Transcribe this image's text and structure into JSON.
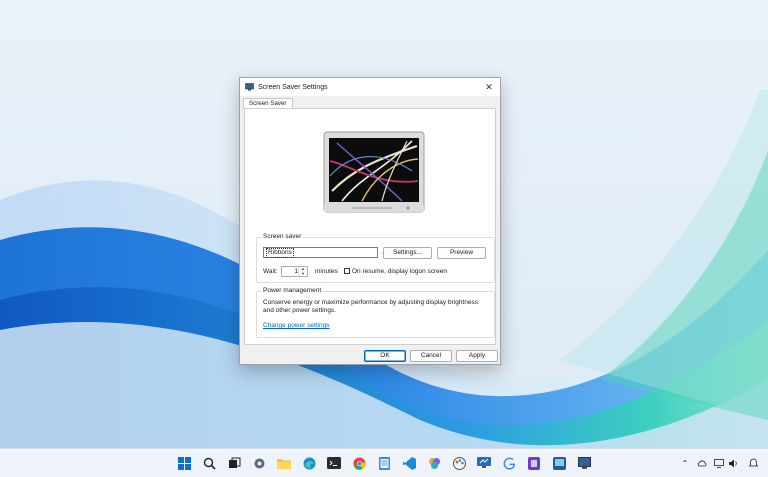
{
  "dialog": {
    "title": "Screen Saver Settings",
    "close_glyph": "✕",
    "tab_label": "Screen Saver"
  },
  "screen_saver": {
    "group_label": "Screen saver",
    "selected": "Ribbons",
    "settings_button": "Settings...",
    "preview_button": "Preview",
    "wait_label": "Wait:",
    "wait_value": "1",
    "minutes_label": "minutes",
    "resume_label": "On resume, display logon screen",
    "resume_checked": false
  },
  "power": {
    "group_label": "Power management",
    "description": "Conserve energy or maximize performance by adjusting display brightness and other power settings.",
    "link": "Change power settings"
  },
  "buttons": {
    "ok": "OK",
    "cancel": "Cancel",
    "apply": "Apply"
  },
  "taskbar": {
    "icons": [
      "windows-start-icon",
      "search-icon",
      "task-view-icon",
      "settings-icon",
      "file-explorer-icon",
      "edge-icon",
      "terminal-icon",
      "chrome-icon",
      "notepad-icon",
      "vscode-icon",
      "copilot-icon",
      "paint-icon",
      "remote-desktop-icon",
      "google-icon",
      "app-icon",
      "snipping-tool-icon",
      "screen-saver-icon"
    ],
    "tray": [
      "chevron-up-icon",
      "onedrive-icon",
      "display-icon",
      "volume-icon",
      "notification-icon"
    ]
  },
  "colors": {
    "accent": "#0067c0",
    "link": "#0066cc"
  }
}
